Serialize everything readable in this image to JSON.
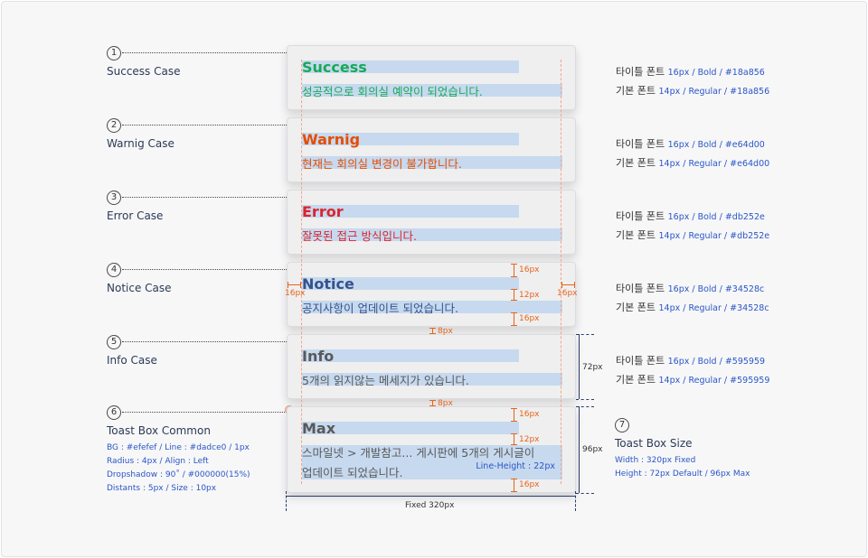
{
  "callouts": [
    {
      "num": "1",
      "label": "Success Case"
    },
    {
      "num": "2",
      "label": "Warnig Case"
    },
    {
      "num": "3",
      "label": "Error Case"
    },
    {
      "num": "4",
      "label": "Notice Case"
    },
    {
      "num": "5",
      "label": "Info Case"
    },
    {
      "num": "6",
      "label": "Toast Box Common",
      "specs": [
        "BG : #efefef / Line : #dadce0 / 1px",
        "Radius : 4px / Align : Left",
        "Dropshadow : 90˚ / #000000(15%)",
        "Distants : 5px / Size : 10px"
      ]
    },
    {
      "num": "7",
      "label": "Toast Box Size",
      "specs": [
        "Width : 320px Fixed",
        "Height : 72px Default / 96px Max"
      ]
    }
  ],
  "toasts": [
    {
      "title": "Success",
      "body": "성공적으로 회의실 예약이 되었습니다.",
      "color": "#18a856"
    },
    {
      "title": "Warnig",
      "body": "현재는 회의실 변경이 불가합니다.",
      "color": "#e64d00"
    },
    {
      "title": "Error",
      "body": "잘못된 접근 방식입니다.",
      "color": "#db252e"
    },
    {
      "title": "Notice",
      "body": "공지사항이 업데이트 되었습니다.",
      "color": "#34528c"
    },
    {
      "title": "Info",
      "body": "5개의 읽지않는 메세지가 있습니다.",
      "color": "#595959"
    },
    {
      "title": "Max",
      "body1": "스마일넷 > 개발참고... 게시판에 5개의 게시글이",
      "body2": "업데이트 되었습니다.",
      "color": "#595959"
    }
  ],
  "font_specs": [
    {
      "title_label": "타이틀 폰트",
      "title_val": "16px / Bold / #18a856",
      "body_label": "기본 폰트",
      "body_val": "14px / Regular / #18a856"
    },
    {
      "title_label": "타이틀 폰트",
      "title_val": "16px / Bold / #e64d00",
      "body_label": "기본 폰트",
      "body_val": "14px / Regular / #e64d00"
    },
    {
      "title_label": "타이틀 폰트",
      "title_val": "16px / Bold / #db252e",
      "body_label": "기본 폰트",
      "body_val": "14px / Regular / #db252e"
    },
    {
      "title_label": "타이틀 폰트",
      "title_val": "16px / Bold / #34528c",
      "body_label": "기본 폰트",
      "body_val": "14px / Regular / #34528c"
    },
    {
      "title_label": "타이틀 폰트",
      "title_val": "16px / Bold / #595959",
      "body_label": "기본 폰트",
      "body_val": "14px / Regular / #595959"
    }
  ],
  "measures": {
    "p16": "16px",
    "p12": "12px",
    "p8": "8px",
    "h72": "72px",
    "h96": "96px",
    "fixed": "Fixed 320px",
    "line_height": "Line-Height : 22px"
  }
}
